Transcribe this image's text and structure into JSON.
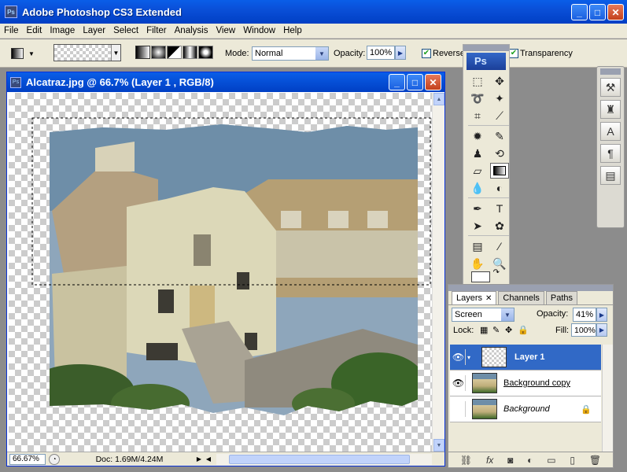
{
  "app": {
    "title": "Adobe Photoshop CS3 Extended",
    "logo": "Ps"
  },
  "menu": [
    "File",
    "Edit",
    "Image",
    "Layer",
    "Select",
    "Filter",
    "Analysis",
    "View",
    "Window",
    "Help"
  ],
  "options": {
    "mode_label": "Mode:",
    "mode_value": "Normal",
    "opacity_label": "Opacity:",
    "opacity_value": "100%",
    "reverse_label": "Reverse",
    "reverse_checked": true,
    "transparency_label": "Transparency",
    "transparency_checked": true
  },
  "document": {
    "title": "Alcatraz.jpg @ 66.7% (Layer 1 , RGB/8)",
    "zoom": "66.67%",
    "doc_info": "Doc: 1.69M/4.24M"
  },
  "toolbox": {
    "badge": "Ps"
  },
  "layers_panel": {
    "tabs": [
      "Layers",
      "Channels",
      "Paths"
    ],
    "blend_mode": "Screen",
    "opacity_label": "Opacity:",
    "opacity_value": "41%",
    "lock_label": "Lock:",
    "fill_label": "Fill:",
    "fill_value": "100%",
    "layers": [
      {
        "name": "Layer 1",
        "visible": true,
        "selected": true
      },
      {
        "name": "Background copy",
        "visible": true,
        "selected": false
      },
      {
        "name": "Background",
        "visible": false,
        "selected": false,
        "locked": true
      }
    ]
  },
  "colors": {
    "xp_blue": "#0a5ee8",
    "selected_layer": "#3169c6",
    "chrome": "#ece9d8"
  }
}
